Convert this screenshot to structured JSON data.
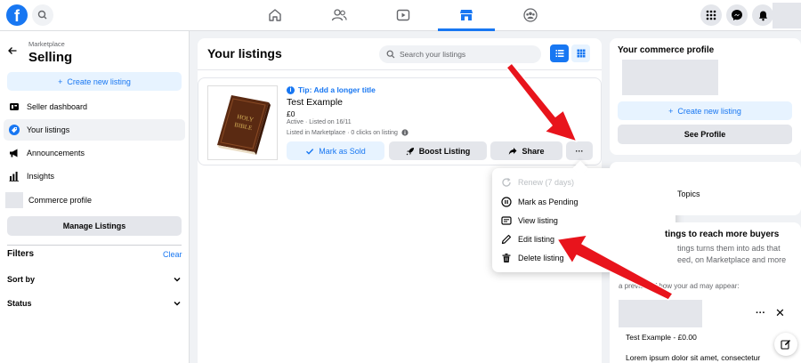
{
  "app": {
    "logo": "f"
  },
  "icons": {
    "search": "search-icon",
    "home": "home-icon",
    "friends": "friends-icon",
    "watch": "watch-icon",
    "marketplace": "marketplace-icon",
    "groups": "groups-icon",
    "menu": "menu-grid-icon",
    "messenger": "messenger-icon",
    "notifications": "bell-icon"
  },
  "sidebar": {
    "breadcrumb": "Marketplace",
    "title": "Selling",
    "create_label": "Create new listing",
    "items": [
      {
        "label": "Seller dashboard",
        "icon": "dashboard-icon"
      },
      {
        "label": "Your listings",
        "icon": "tag-icon",
        "active": true
      },
      {
        "label": "Announcements",
        "icon": "megaphone-icon"
      },
      {
        "label": "Insights",
        "icon": "chart-icon"
      },
      {
        "label": "Commerce profile",
        "icon": "profile-placeholder"
      }
    ],
    "manage_label": "Manage Listings",
    "filters_title": "Filters",
    "clear_label": "Clear",
    "filters": [
      {
        "label": "Sort by"
      },
      {
        "label": "Status"
      }
    ]
  },
  "main": {
    "title": "Your listings",
    "search_placeholder": "Search your listings",
    "listing": {
      "tip": "Tip: Add a longer title",
      "name": "Test Example",
      "price": "£0",
      "status": "Active · Listed on 16/11",
      "meta": "Listed in Marketplace · 0 clicks on listing",
      "actions": {
        "mark_sold": "Mark as Sold",
        "boost": "Boost Listing",
        "share": "Share",
        "more": "···"
      }
    }
  },
  "menu": {
    "items": [
      {
        "label": "Renew (7 days)",
        "disabled": true
      },
      {
        "label": "Mark as Pending"
      },
      {
        "label": "View listing"
      },
      {
        "label": "Edit listing"
      },
      {
        "label": "Delete listing"
      }
    ]
  },
  "right": {
    "profile_title": "Your commerce profile",
    "create_label": "Create new listing",
    "see_profile": "See Profile",
    "topics_label": "Topics",
    "boost_title": "tings to reach more buyers",
    "boost_line1": "tings turns them into ads that",
    "boost_line2": "eed, on Marketplace and more",
    "preview_text": "a preview of how your ad may appear:",
    "ad_title": "Test Example - £0.00",
    "lorem": "Lorem ipsum dolor sit amet, consectetur"
  },
  "colors": {
    "accent": "#1877f2",
    "arrow": "#e8141c"
  }
}
